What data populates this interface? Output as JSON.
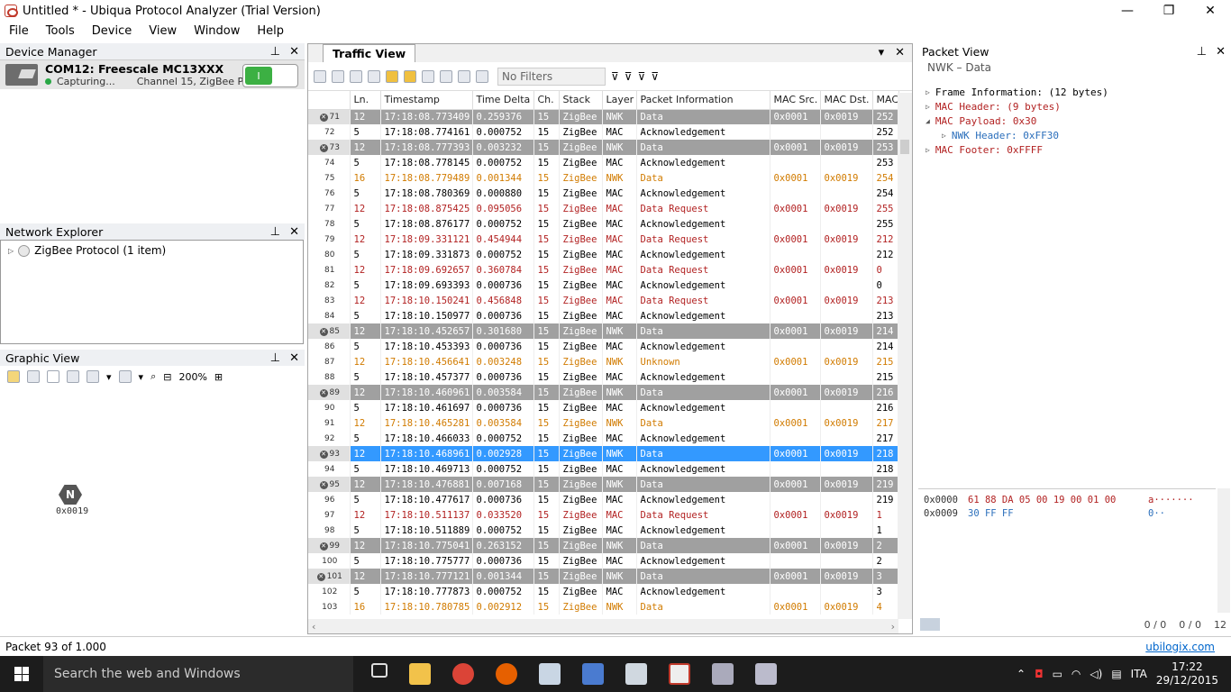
{
  "window": {
    "title": "Untitled * - Ubiqua Protocol Analyzer (Trial Version)",
    "minimize": "—",
    "maximize": "❐",
    "close": "✕"
  },
  "menu": [
    "File",
    "Tools",
    "Device",
    "View",
    "Window",
    "Help"
  ],
  "device_manager": {
    "title": "Device Manager",
    "device_name": "COM12: Freescale MC13XXX",
    "status": "Capturing...",
    "channel": "Channel 15, ZigBee Protocol",
    "toggle_label": "I"
  },
  "network_explorer": {
    "title": "Network Explorer",
    "item": "ZigBee Protocol (1 item)"
  },
  "graphic_view": {
    "title": "Graphic View",
    "zoom": "200%",
    "node_letter": "N",
    "node_address": "0x0019"
  },
  "traffic_view": {
    "title": "Traffic View",
    "filter": "No Filters",
    "columns": [
      "Ln.",
      "Timestamp",
      "Time Delta",
      "Ch.",
      "Stack",
      "Layer",
      "Packet Information",
      "MAC Src.",
      "MAC Dst.",
      "MAC"
    ],
    "rows": [
      {
        "num": "71",
        "ln": "12",
        "ts": "17:18:08.773409",
        "td": "0.259376",
        "ch": "15",
        "stack": "ZigBee",
        "layer": "NWK",
        "info": "Data",
        "src": "0x0001",
        "dst": "0x0019",
        "mac": "252",
        "style": "gray",
        "x": true
      },
      {
        "num": "72",
        "ln": "5",
        "ts": "17:18:08.774161",
        "td": "0.000752",
        "ch": "15",
        "stack": "ZigBee",
        "layer": "MAC",
        "info": "Acknowledgement",
        "src": "",
        "dst": "",
        "mac": "252",
        "style": "",
        "x": false
      },
      {
        "num": "73",
        "ln": "12",
        "ts": "17:18:08.777393",
        "td": "0.003232",
        "ch": "15",
        "stack": "ZigBee",
        "layer": "NWK",
        "info": "Data",
        "src": "0x0001",
        "dst": "0x0019",
        "mac": "253",
        "style": "gray",
        "x": true
      },
      {
        "num": "74",
        "ln": "5",
        "ts": "17:18:08.778145",
        "td": "0.000752",
        "ch": "15",
        "stack": "ZigBee",
        "layer": "MAC",
        "info": "Acknowledgement",
        "src": "",
        "dst": "",
        "mac": "253",
        "style": "",
        "x": false
      },
      {
        "num": "75",
        "ln": "16",
        "ts": "17:18:08.779489",
        "td": "0.001344",
        "ch": "15",
        "stack": "ZigBee",
        "layer": "NWK",
        "info": "Data",
        "src": "0x0001",
        "dst": "0x0019",
        "mac": "254",
        "style": "orange",
        "x": false
      },
      {
        "num": "76",
        "ln": "5",
        "ts": "17:18:08.780369",
        "td": "0.000880",
        "ch": "15",
        "stack": "ZigBee",
        "layer": "MAC",
        "info": "Acknowledgement",
        "src": "",
        "dst": "",
        "mac": "254",
        "style": "",
        "x": false
      },
      {
        "num": "77",
        "ln": "12",
        "ts": "17:18:08.875425",
        "td": "0.095056",
        "ch": "15",
        "stack": "ZigBee",
        "layer": "MAC",
        "info": "Data Request",
        "src": "0x0001",
        "dst": "0x0019",
        "mac": "255",
        "style": "red",
        "x": false
      },
      {
        "num": "78",
        "ln": "5",
        "ts": "17:18:08.876177",
        "td": "0.000752",
        "ch": "15",
        "stack": "ZigBee",
        "layer": "MAC",
        "info": "Acknowledgement",
        "src": "",
        "dst": "",
        "mac": "255",
        "style": "",
        "x": false
      },
      {
        "num": "79",
        "ln": "12",
        "ts": "17:18:09.331121",
        "td": "0.454944",
        "ch": "15",
        "stack": "ZigBee",
        "layer": "MAC",
        "info": "Data Request",
        "src": "0x0001",
        "dst": "0x0019",
        "mac": "212",
        "style": "red",
        "x": false
      },
      {
        "num": "80",
        "ln": "5",
        "ts": "17:18:09.331873",
        "td": "0.000752",
        "ch": "15",
        "stack": "ZigBee",
        "layer": "MAC",
        "info": "Acknowledgement",
        "src": "",
        "dst": "",
        "mac": "212",
        "style": "",
        "x": false
      },
      {
        "num": "81",
        "ln": "12",
        "ts": "17:18:09.692657",
        "td": "0.360784",
        "ch": "15",
        "stack": "ZigBee",
        "layer": "MAC",
        "info": "Data Request",
        "src": "0x0001",
        "dst": "0x0019",
        "mac": "0",
        "style": "red",
        "x": false
      },
      {
        "num": "82",
        "ln": "5",
        "ts": "17:18:09.693393",
        "td": "0.000736",
        "ch": "15",
        "stack": "ZigBee",
        "layer": "MAC",
        "info": "Acknowledgement",
        "src": "",
        "dst": "",
        "mac": "0",
        "style": "",
        "x": false
      },
      {
        "num": "83",
        "ln": "12",
        "ts": "17:18:10.150241",
        "td": "0.456848",
        "ch": "15",
        "stack": "ZigBee",
        "layer": "MAC",
        "info": "Data Request",
        "src": "0x0001",
        "dst": "0x0019",
        "mac": "213",
        "style": "red",
        "x": false
      },
      {
        "num": "84",
        "ln": "5",
        "ts": "17:18:10.150977",
        "td": "0.000736",
        "ch": "15",
        "stack": "ZigBee",
        "layer": "MAC",
        "info": "Acknowledgement",
        "src": "",
        "dst": "",
        "mac": "213",
        "style": "",
        "x": false
      },
      {
        "num": "85",
        "ln": "12",
        "ts": "17:18:10.452657",
        "td": "0.301680",
        "ch": "15",
        "stack": "ZigBee",
        "layer": "NWK",
        "info": "Data",
        "src": "0x0001",
        "dst": "0x0019",
        "mac": "214",
        "style": "gray",
        "x": true
      },
      {
        "num": "86",
        "ln": "5",
        "ts": "17:18:10.453393",
        "td": "0.000736",
        "ch": "15",
        "stack": "ZigBee",
        "layer": "MAC",
        "info": "Acknowledgement",
        "src": "",
        "dst": "",
        "mac": "214",
        "style": "",
        "x": false
      },
      {
        "num": "87",
        "ln": "12",
        "ts": "17:18:10.456641",
        "td": "0.003248",
        "ch": "15",
        "stack": "ZigBee",
        "layer": "NWK",
        "info": "Unknown",
        "src": "0x0001",
        "dst": "0x0019",
        "mac": "215",
        "style": "orange",
        "x": false
      },
      {
        "num": "88",
        "ln": "5",
        "ts": "17:18:10.457377",
        "td": "0.000736",
        "ch": "15",
        "stack": "ZigBee",
        "layer": "MAC",
        "info": "Acknowledgement",
        "src": "",
        "dst": "",
        "mac": "215",
        "style": "",
        "x": false
      },
      {
        "num": "89",
        "ln": "12",
        "ts": "17:18:10.460961",
        "td": "0.003584",
        "ch": "15",
        "stack": "ZigBee",
        "layer": "NWK",
        "info": "Data",
        "src": "0x0001",
        "dst": "0x0019",
        "mac": "216",
        "style": "gray",
        "x": true
      },
      {
        "num": "90",
        "ln": "5",
        "ts": "17:18:10.461697",
        "td": "0.000736",
        "ch": "15",
        "stack": "ZigBee",
        "layer": "MAC",
        "info": "Acknowledgement",
        "src": "",
        "dst": "",
        "mac": "216",
        "style": "",
        "x": false
      },
      {
        "num": "91",
        "ln": "12",
        "ts": "17:18:10.465281",
        "td": "0.003584",
        "ch": "15",
        "stack": "ZigBee",
        "layer": "NWK",
        "info": "Data",
        "src": "0x0001",
        "dst": "0x0019",
        "mac": "217",
        "style": "orange",
        "x": false
      },
      {
        "num": "92",
        "ln": "5",
        "ts": "17:18:10.466033",
        "td": "0.000752",
        "ch": "15",
        "stack": "ZigBee",
        "layer": "MAC",
        "info": "Acknowledgement",
        "src": "",
        "dst": "",
        "mac": "217",
        "style": "",
        "x": false
      },
      {
        "num": "93",
        "ln": "12",
        "ts": "17:18:10.468961",
        "td": "0.002928",
        "ch": "15",
        "stack": "ZigBee",
        "layer": "NWK",
        "info": "Data",
        "src": "0x0001",
        "dst": "0x0019",
        "mac": "218",
        "style": "sel",
        "x": true
      },
      {
        "num": "94",
        "ln": "5",
        "ts": "17:18:10.469713",
        "td": "0.000752",
        "ch": "15",
        "stack": "ZigBee",
        "layer": "MAC",
        "info": "Acknowledgement",
        "src": "",
        "dst": "",
        "mac": "218",
        "style": "",
        "x": false
      },
      {
        "num": "95",
        "ln": "12",
        "ts": "17:18:10.476881",
        "td": "0.007168",
        "ch": "15",
        "stack": "ZigBee",
        "layer": "NWK",
        "info": "Data",
        "src": "0x0001",
        "dst": "0x0019",
        "mac": "219",
        "style": "gray",
        "x": true
      },
      {
        "num": "96",
        "ln": "5",
        "ts": "17:18:10.477617",
        "td": "0.000736",
        "ch": "15",
        "stack": "ZigBee",
        "layer": "MAC",
        "info": "Acknowledgement",
        "src": "",
        "dst": "",
        "mac": "219",
        "style": "",
        "x": false
      },
      {
        "num": "97",
        "ln": "12",
        "ts": "17:18:10.511137",
        "td": "0.033520",
        "ch": "15",
        "stack": "ZigBee",
        "layer": "MAC",
        "info": "Data Request",
        "src": "0x0001",
        "dst": "0x0019",
        "mac": "1",
        "style": "red",
        "x": false
      },
      {
        "num": "98",
        "ln": "5",
        "ts": "17:18:10.511889",
        "td": "0.000752",
        "ch": "15",
        "stack": "ZigBee",
        "layer": "MAC",
        "info": "Acknowledgement",
        "src": "",
        "dst": "",
        "mac": "1",
        "style": "",
        "x": false
      },
      {
        "num": "99",
        "ln": "12",
        "ts": "17:18:10.775041",
        "td": "0.263152",
        "ch": "15",
        "stack": "ZigBee",
        "layer": "NWK",
        "info": "Data",
        "src": "0x0001",
        "dst": "0x0019",
        "mac": "2",
        "style": "gray",
        "x": true
      },
      {
        "num": "100",
        "ln": "5",
        "ts": "17:18:10.775777",
        "td": "0.000736",
        "ch": "15",
        "stack": "ZigBee",
        "layer": "MAC",
        "info": "Acknowledgement",
        "src": "",
        "dst": "",
        "mac": "2",
        "style": "",
        "x": false
      },
      {
        "num": "101",
        "ln": "12",
        "ts": "17:18:10.777121",
        "td": "0.001344",
        "ch": "15",
        "stack": "ZigBee",
        "layer": "NWK",
        "info": "Data",
        "src": "0x0001",
        "dst": "0x0019",
        "mac": "3",
        "style": "gray",
        "x": true
      },
      {
        "num": "102",
        "ln": "5",
        "ts": "17:18:10.777873",
        "td": "0.000752",
        "ch": "15",
        "stack": "ZigBee",
        "layer": "MAC",
        "info": "Acknowledgement",
        "src": "",
        "dst": "",
        "mac": "3",
        "style": "",
        "x": false
      },
      {
        "num": "103",
        "ln": "16",
        "ts": "17:18:10.780785",
        "td": "0.002912",
        "ch": "15",
        "stack": "ZigBee",
        "layer": "NWK",
        "info": "Data",
        "src": "0x0001",
        "dst": "0x0019",
        "mac": "4",
        "style": "orange",
        "x": false
      }
    ]
  },
  "packet_view": {
    "title": "Packet View",
    "subtitle": "NWK – Data",
    "tree": [
      {
        "label": "Frame Information: (12 bytes)",
        "indent": 0,
        "color": "#000000",
        "exp": "▷"
      },
      {
        "label": "MAC Header: (9 bytes)",
        "indent": 0,
        "color": "#b22222",
        "exp": "▷"
      },
      {
        "label": "MAC Payload: 0x30",
        "indent": 0,
        "color": "#b22222",
        "exp": "◢"
      },
      {
        "label": "NWK Header: 0xFF30",
        "indent": 1,
        "color": "#2a6ebb",
        "exp": "▷"
      },
      {
        "label": "MAC Footer: 0xFFFF",
        "indent": 0,
        "color": "#b22222",
        "exp": "▷"
      }
    ],
    "hex": [
      {
        "off": "0x0000",
        "bytes": "61 88 DA 05 00 19 00 01 00",
        "asc": "a·······"
      },
      {
        "off": "0x0009",
        "bytes": "30 FF FF",
        "asc": "0··"
      }
    ],
    "status_a": "0 / 0",
    "status_b": "0 / 0",
    "status_c": "12"
  },
  "statusbar": {
    "packet": "Packet 93 of 1.000",
    "link": "ubilogix.com"
  },
  "taskbar": {
    "search": "Search the web and Windows",
    "lang": "ITA",
    "time": "17:22",
    "date": "29/12/2015"
  },
  "colors": {
    "gray_row": "#a0a0a0",
    "selected_row": "#3399ff",
    "orange_text": "#d17b00",
    "red_text": "#b22222",
    "accent": "#0066cc"
  }
}
